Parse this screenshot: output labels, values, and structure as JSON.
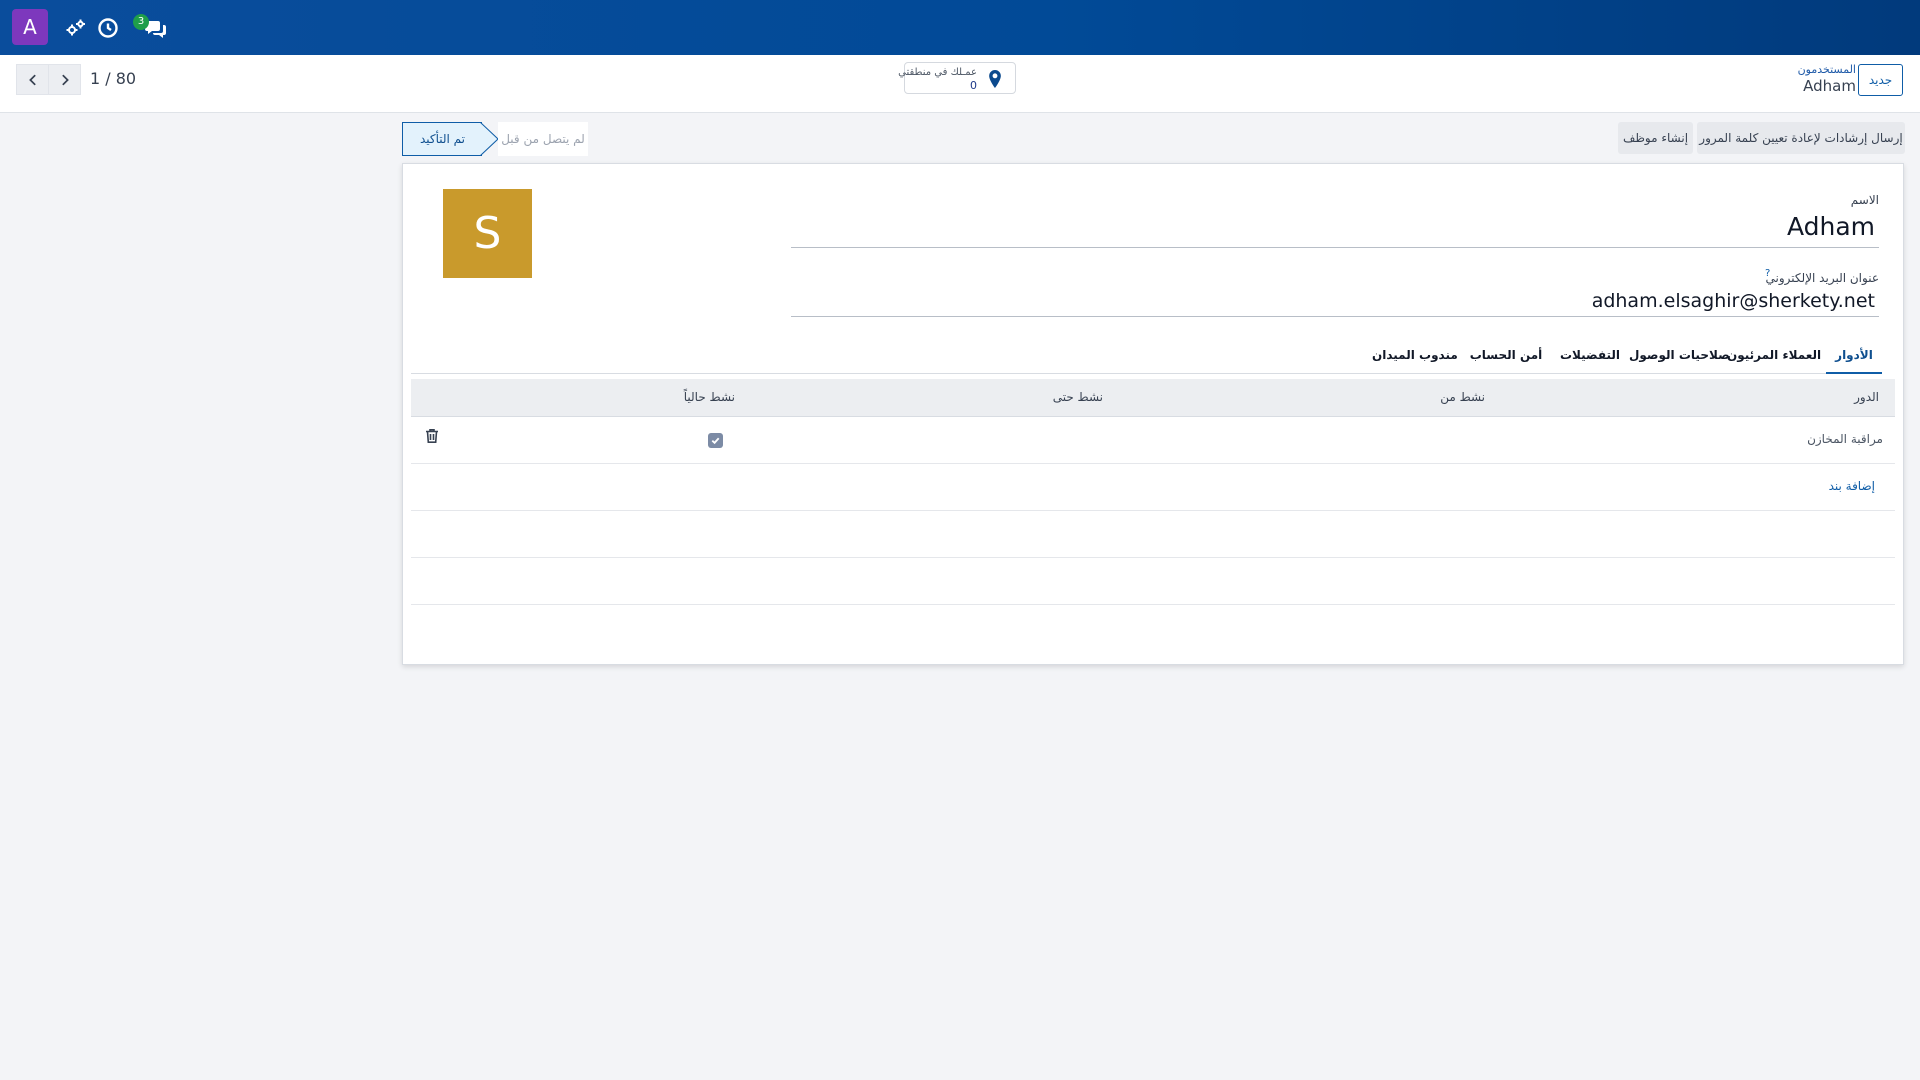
{
  "navbar": {
    "avatar_letter": "A",
    "icons": [
      "settings-gears-icon",
      "clock-icon",
      "chat-icon"
    ],
    "chat_badge": "3"
  },
  "control_panel": {
    "pager": "1 / 80",
    "location": {
      "label": "عمـلك في منطقتي",
      "count": "0"
    },
    "breadcrumb": {
      "parent": "المستخدمون",
      "current": "Adham"
    },
    "new_button": "جديد"
  },
  "header": {
    "buttons": [
      "إرسال إرشادات لإعادة تعيين كلمة المرور",
      "إنشاء موظف"
    ],
    "status": {
      "active": "تم التأكيد",
      "inactive": "لم يتصل من قبل"
    }
  },
  "form": {
    "avatar_letter": "S",
    "name_label": "الاسم",
    "name_value": "Adham",
    "email_label": "عنوان البريد الإلكتروني",
    "email_help": "?",
    "email_value": "adham.elsaghir@sherkety.net",
    "tabs": [
      "الأدوار",
      "العملاء المرئيون",
      "صلاحيات الوصول",
      "التفضيلات",
      "أمن الحساب",
      "مندوب الميدان"
    ],
    "roles_table": {
      "columns": [
        "الدور",
        "نشط من",
        "نشط حتى",
        "نشط حالياً"
      ],
      "rows": [
        {
          "role": "مراقبة المخازن",
          "active_from": "",
          "active_to": "",
          "currently_active": true
        }
      ],
      "add_line": "إضافة بند"
    }
  }
}
